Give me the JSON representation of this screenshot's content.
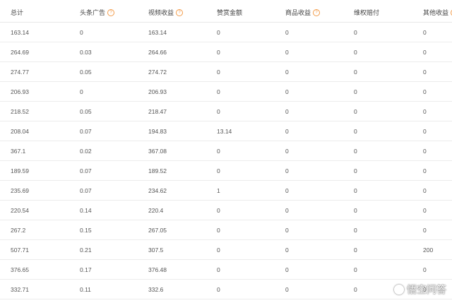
{
  "header": {
    "total": "总计",
    "toutiao_ad": "头条广告",
    "video_income": "视频收益",
    "reward_amount": "赞赏金额",
    "product_income": "商品收益",
    "rights_comp": "维权赔付",
    "other_income": "其他收益",
    "help_glyph": "?"
  },
  "rows": [
    [
      "163.14",
      "0",
      "163.14",
      "0",
      "0",
      "0",
      "0"
    ],
    [
      "264.69",
      "0.03",
      "264.66",
      "0",
      "0",
      "0",
      "0"
    ],
    [
      "274.77",
      "0.05",
      "274.72",
      "0",
      "0",
      "0",
      "0"
    ],
    [
      "206.93",
      "0",
      "206.93",
      "0",
      "0",
      "0",
      "0"
    ],
    [
      "218.52",
      "0.05",
      "218.47",
      "0",
      "0",
      "0",
      "0"
    ],
    [
      "208.04",
      "0.07",
      "194.83",
      "13.14",
      "0",
      "0",
      "0"
    ],
    [
      "367.1",
      "0.02",
      "367.08",
      "0",
      "0",
      "0",
      "0"
    ],
    [
      "189.59",
      "0.07",
      "189.52",
      "0",
      "0",
      "0",
      "0"
    ],
    [
      "235.69",
      "0.07",
      "234.62",
      "1",
      "0",
      "0",
      "0"
    ],
    [
      "220.54",
      "0.14",
      "220.4",
      "0",
      "0",
      "0",
      "0"
    ],
    [
      "267.2",
      "0.15",
      "267.05",
      "0",
      "0",
      "0",
      "0"
    ],
    [
      "507.71",
      "0.21",
      "307.5",
      "0",
      "0",
      "0",
      "200"
    ],
    [
      "376.65",
      "0.17",
      "376.48",
      "0",
      "0",
      "0",
      "0"
    ],
    [
      "332.71",
      "0.11",
      "332.6",
      "0",
      "0",
      "0",
      "0"
    ]
  ],
  "watermark": {
    "text": "悟空问答"
  }
}
